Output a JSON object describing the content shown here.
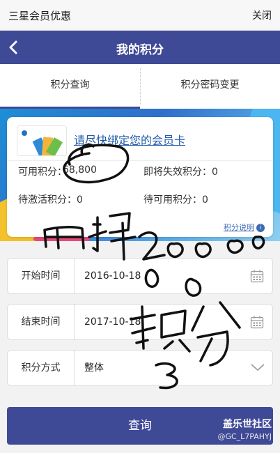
{
  "topbar": {
    "title": "三星会员优惠",
    "close_label": "关闭"
  },
  "header": {
    "title": "我的积分"
  },
  "tabs": [
    {
      "label": "积分查询",
      "active": true
    },
    {
      "label": "积分密码变更",
      "active": false
    }
  ],
  "card": {
    "bind_prompt": "请尽快绑定您的会员卡",
    "available_label": "可用积分：",
    "available_value": "68,800",
    "expiring_label": "即将失效积分：0",
    "pending_activation_label": "待激活积分：0",
    "pending_available_label": "待可用积分：0",
    "explain_label": "积分说明",
    "explain_icon": "info-icon"
  },
  "form": {
    "start_label": "开始时间",
    "start_value": "2016-10-18",
    "end_label": "结束时间",
    "end_value": "2017-10-18",
    "mode_label": "积分方式",
    "mode_value": "整体"
  },
  "query_label": "查询",
  "watermark": {
    "site": "盖乐世社区",
    "user": "@GC_L7PAHYJ"
  },
  "colors": {
    "accent": "#3f4a97",
    "link": "#1f5aa8"
  }
}
